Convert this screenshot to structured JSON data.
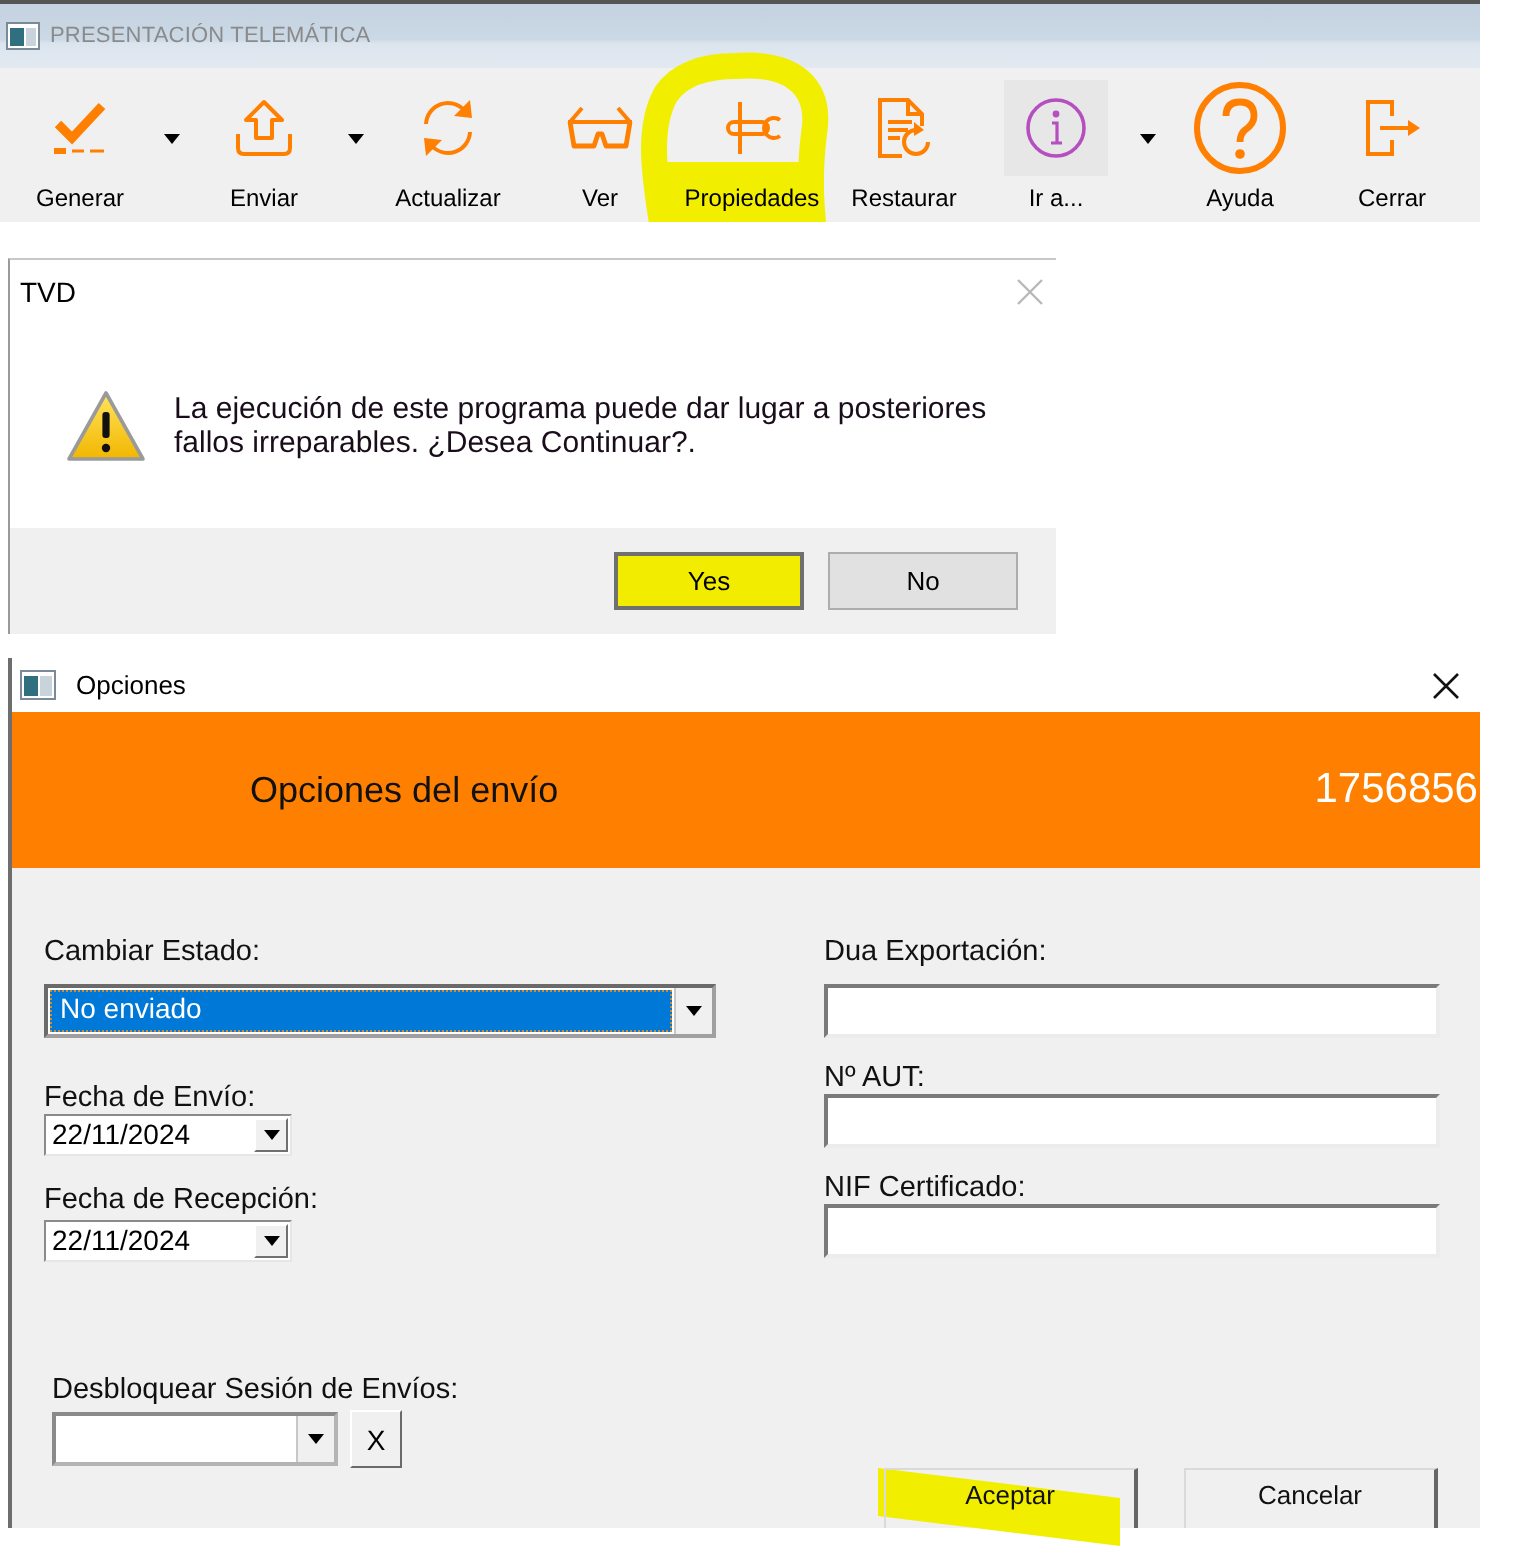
{
  "main_window": {
    "title": "PRESENTACIÓN TELEMÁTICA",
    "toolbar": [
      {
        "label": "Generar",
        "dropdown": true,
        "hovered": false,
        "highlighted": false
      },
      {
        "label": "Enviar",
        "dropdown": true,
        "hovered": false,
        "highlighted": false
      },
      {
        "label": "Actualizar",
        "dropdown": false,
        "hovered": false,
        "highlighted": false
      },
      {
        "label": "Ver",
        "dropdown": false,
        "hovered": false,
        "highlighted": false
      },
      {
        "label": "Propiedades",
        "dropdown": false,
        "hovered": false,
        "highlighted": true
      },
      {
        "label": "Restaurar",
        "dropdown": false,
        "hovered": false,
        "highlighted": false
      },
      {
        "label": "Ir a...",
        "dropdown": true,
        "hovered": true,
        "highlighted": false
      },
      {
        "label": "Ayuda",
        "dropdown": false,
        "hovered": false,
        "highlighted": false
      },
      {
        "label": "Cerrar",
        "dropdown": false,
        "hovered": false,
        "highlighted": false
      }
    ]
  },
  "confirm_dialog": {
    "title": "TVD",
    "message": "La ejecución de este programa puede dar lugar a posteriores fallos irreparables. ¿Desea Continuar?.",
    "buttons": [
      {
        "label": "Yes",
        "default": true,
        "highlighted": true
      },
      {
        "label": "No",
        "default": false,
        "highlighted": false
      }
    ]
  },
  "options_dialog": {
    "title": "Opciones",
    "header": {
      "title": "Opciones del envío",
      "number": "1756856"
    },
    "left_fields": [
      {
        "kind": "combo",
        "label": "Cambiar Estado:",
        "value": "No enviado",
        "selected": true
      },
      {
        "kind": "date",
        "label": "Fecha de Envío:",
        "value": "22/11/2024"
      },
      {
        "kind": "date",
        "label": "Fecha de Recepción:",
        "value": "22/11/2024"
      },
      {
        "kind": "combo-clear",
        "label": "Desbloquear Sesión de Envíos:",
        "selected": false,
        "clear_button": "X"
      }
    ],
    "right_fields": [
      {
        "label": "Dua Exportación:"
      },
      {
        "label": "Nº AUT:"
      },
      {
        "label": "NIF Certificado:"
      }
    ],
    "buttons": [
      {
        "label": "Aceptar",
        "highlighted": true
      },
      {
        "label": "Cancelar",
        "highlighted": false
      }
    ]
  }
}
